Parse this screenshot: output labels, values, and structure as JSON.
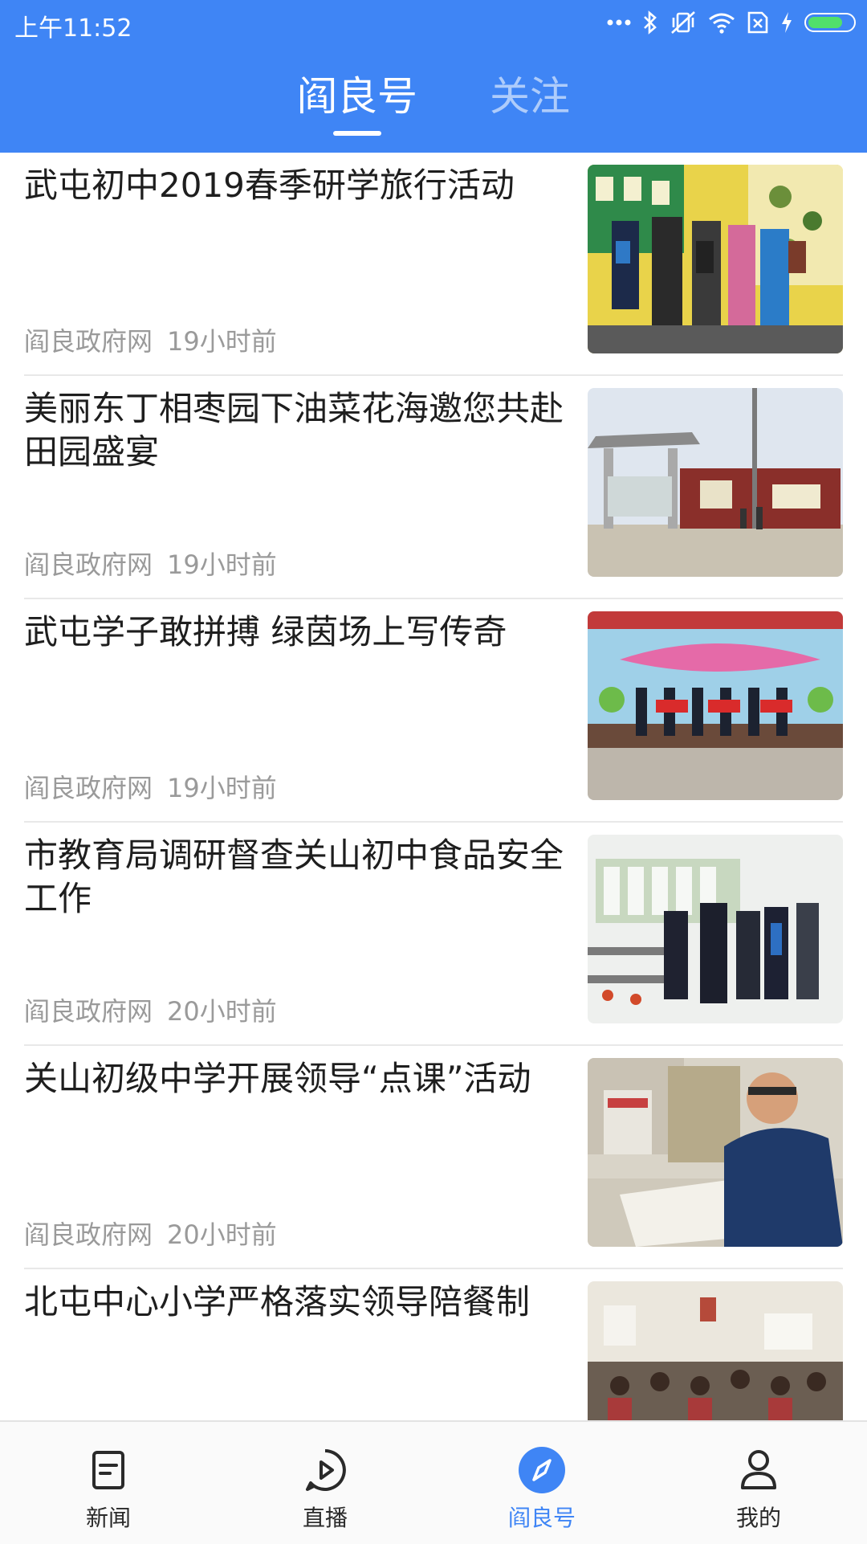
{
  "status_bar": {
    "time": "上午11:52",
    "icons": [
      "more-dots-icon",
      "bluetooth-icon",
      "vibrate-off-icon",
      "wifi-icon",
      "sim-x-icon",
      "charging-icon",
      "battery-icon"
    ]
  },
  "tabs": [
    {
      "label": "阎良号",
      "active": true
    },
    {
      "label": "关注",
      "active": false
    }
  ],
  "articles": [
    {
      "title": "武屯初中2019春季研学旅行活动",
      "source": "阎良政府网",
      "time": "19小时前",
      "image": "students-viewing-exhibits"
    },
    {
      "title": "美丽东丁相枣园下油菜花海邀您共赴田园盛宴",
      "source": "阎良政府网",
      "time": "19小时前",
      "image": "village-gate"
    },
    {
      "title": "武屯学子敢拼搏 绿茵场上写传奇",
      "source": "阎良政府网",
      "time": "19小时前",
      "image": "award-ceremony-stage"
    },
    {
      "title": "市教育局调研督查关山初中食品安全工作",
      "source": "阎良政府网",
      "time": "20小时前",
      "image": "officials-in-cafeteria"
    },
    {
      "title": "关山初级中学开展领导“点课”活动",
      "source": "阎良政府网",
      "time": "20小时前",
      "image": "man-reviewing-papers"
    },
    {
      "title": "北屯中心小学严格落实领导陪餐制",
      "source": "",
      "time": "",
      "image": "school-dining-hall"
    }
  ],
  "bottom_nav": [
    {
      "label": "新闻",
      "icon": "news-icon",
      "active": false
    },
    {
      "label": "直播",
      "icon": "play-icon",
      "active": false
    },
    {
      "label": "阎良号",
      "icon": "compass-icon",
      "active": true
    },
    {
      "label": "我的",
      "icon": "profile-icon",
      "active": false
    }
  ],
  "colors": {
    "primary": "#3f85f5",
    "title_text": "#1e1e1e",
    "meta_text": "#9a9a9a"
  }
}
